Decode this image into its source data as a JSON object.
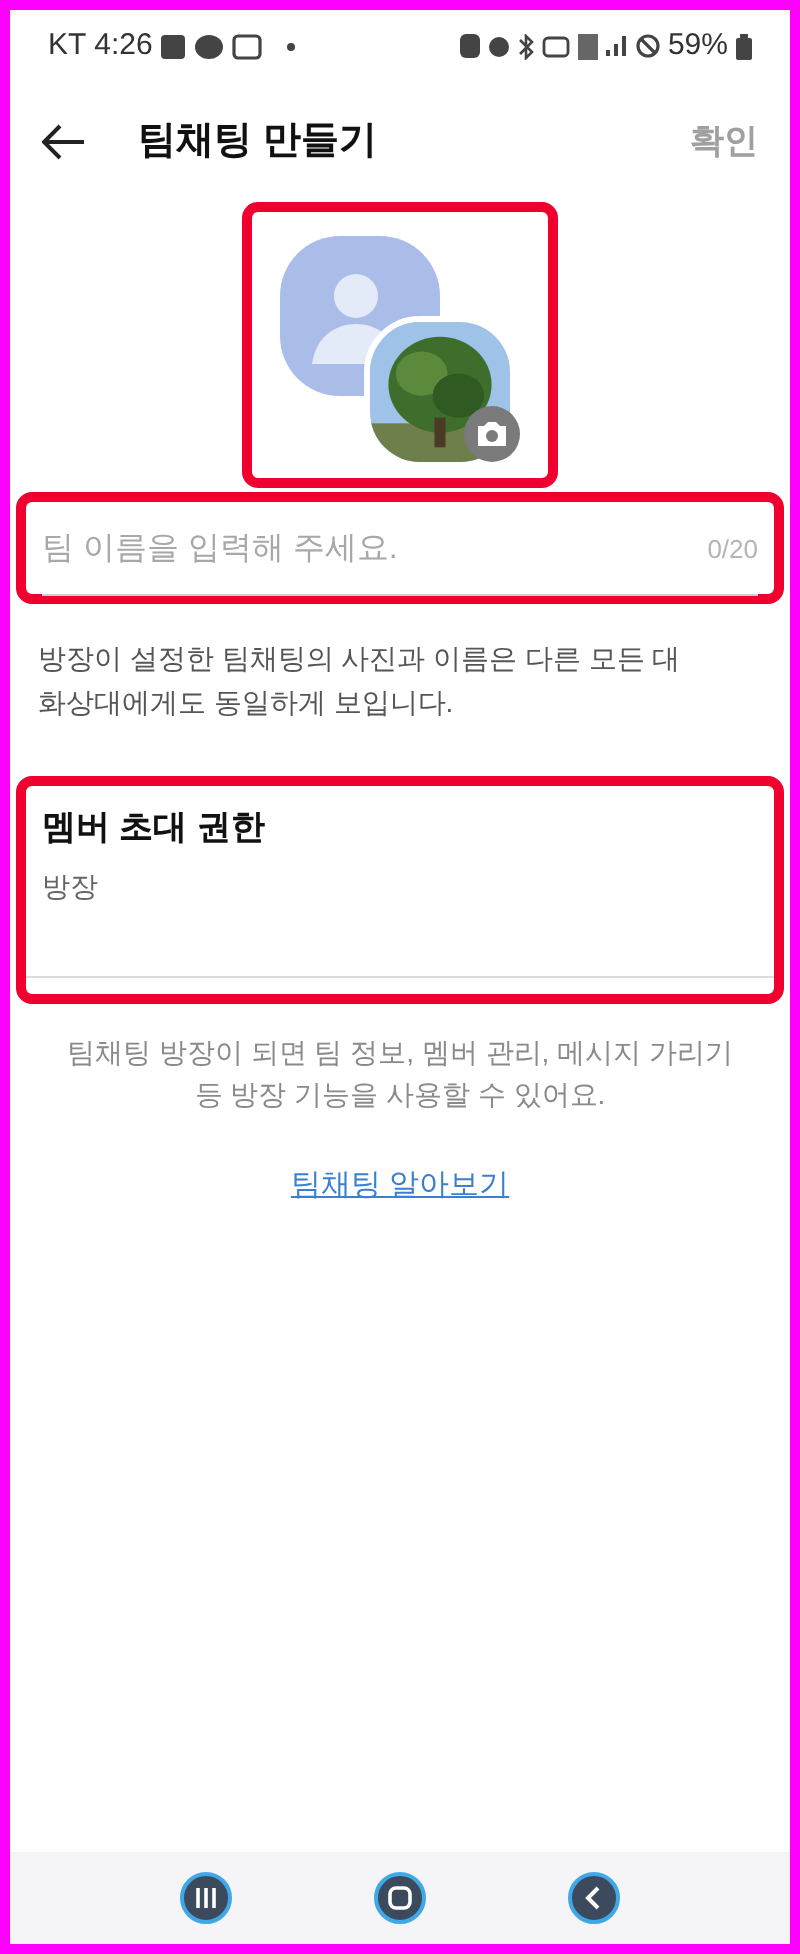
{
  "status_bar": {
    "carrier": "KT",
    "time": "4:26",
    "battery": "59%"
  },
  "header": {
    "title": "팀채팅 만들기",
    "confirm": {
      "label": "확인",
      "disabled": true
    }
  },
  "name_field": {
    "placeholder": "팀 이름을 입력해 주세요.",
    "counter": "0/20"
  },
  "name_help": "방장이 설정한 팀채팅의 사진과 이름은 다른 모든 대화상대에게도 동일하게 보입니다.",
  "invite_permission": {
    "label": "멤버 초대 권한",
    "value": "방장"
  },
  "owner_info": "팀채팅 방장이 되면 팀 정보, 멤버 관리, 메시지 가리기 등 방장 기능을 사용할 수 있어요.",
  "learn_more_link": "팀채팅 알아보기"
}
